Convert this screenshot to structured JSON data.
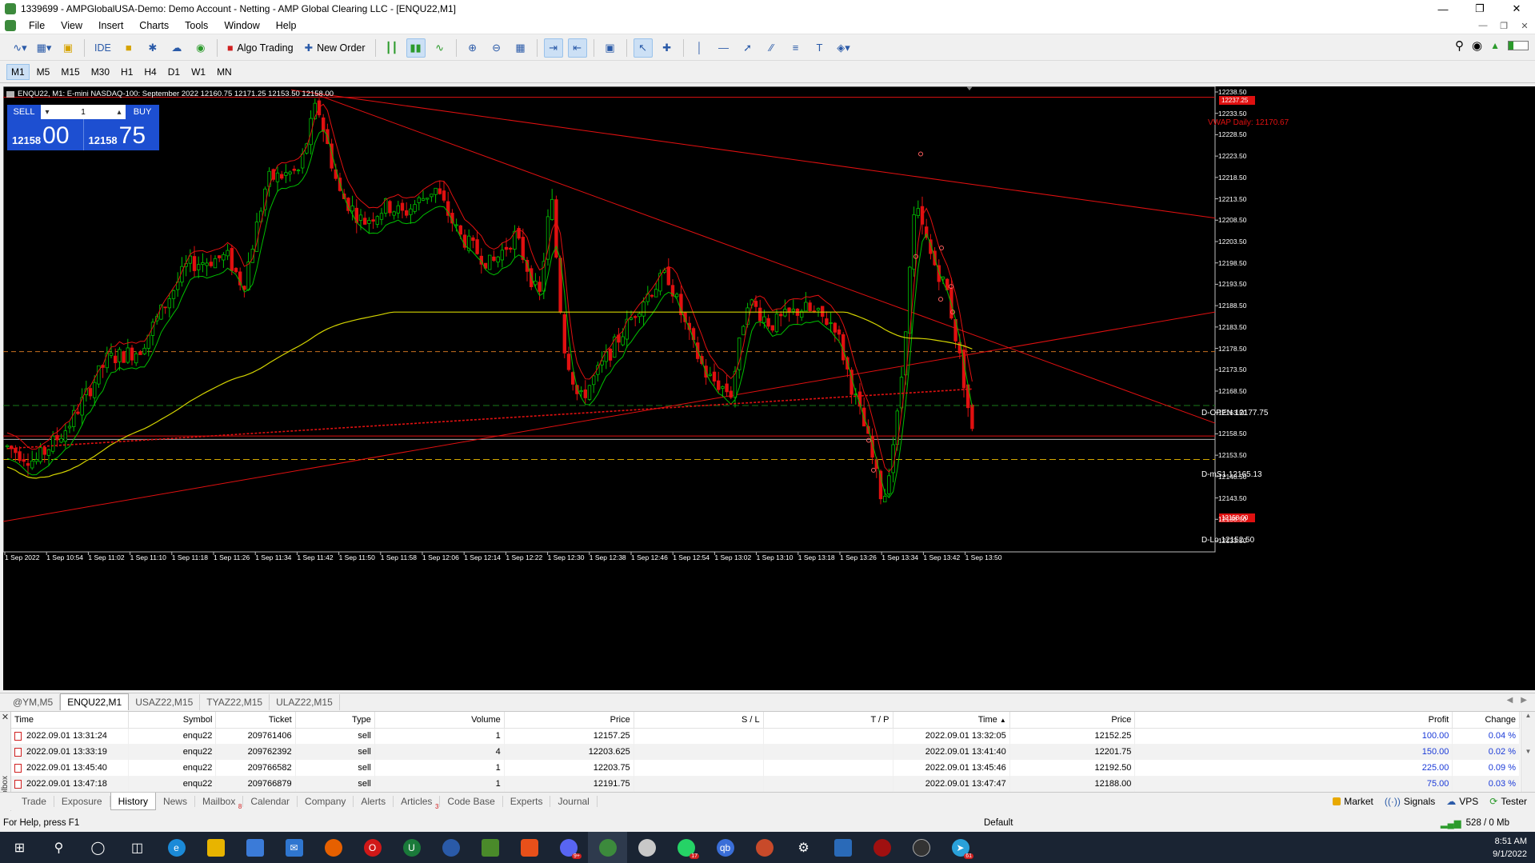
{
  "window": {
    "title": "1339699 - AMPGlobalUSA-Demo: Demo Account - Netting - AMP Global Clearing LLC - [ENQU22,M1]"
  },
  "menu": [
    "File",
    "View",
    "Insert",
    "Charts",
    "Tools",
    "Window",
    "Help"
  ],
  "toolbar": {
    "ide": "IDE",
    "algo_trading": "Algo Trading",
    "new_order": "New Order"
  },
  "timeframes": [
    "M1",
    "M5",
    "M15",
    "M30",
    "H1",
    "H4",
    "D1",
    "W1",
    "MN"
  ],
  "active_timeframe": "M1",
  "chart": {
    "header": "ENQU22, M1:  E-mini NASDAQ-100: September 2022   12160.75  12171.25  12153.50  12158.00",
    "trade_panel": {
      "sell": "SELL",
      "buy": "BUY",
      "qty": "1",
      "bid_small": "12158",
      "bid_big": "00",
      "ask_small": "12158",
      "ask_big": "75"
    },
    "vwap_label": "VWAP Daily: 12170.67",
    "levels": {
      "open": "D-OPEN 12177.75",
      "ms1": "D-mS1 12165.13",
      "lo": "D-Lo 12152.50"
    },
    "price_tag_top": "12237.25",
    "price_tag_current": "12158.00",
    "price_axis": [
      "12238.50",
      "12233.50",
      "12228.50",
      "12223.50",
      "12218.50",
      "12213.50",
      "12208.50",
      "12203.50",
      "12198.50",
      "12193.50",
      "12188.50",
      "12183.50",
      "12178.50",
      "12173.50",
      "12168.50",
      "12163.50",
      "12158.50",
      "12153.50",
      "12148.50",
      "12143.50",
      "12138.50",
      "12133.50"
    ],
    "time_axis": [
      "1 Sep 2022",
      "1 Sep 10:54",
      "1 Sep 11:02",
      "1 Sep 11:10",
      "1 Sep 11:18",
      "1 Sep 11:26",
      "1 Sep 11:34",
      "1 Sep 11:42",
      "1 Sep 11:50",
      "1 Sep 11:58",
      "1 Sep 12:06",
      "1 Sep 12:14",
      "1 Sep 12:22",
      "1 Sep 12:30",
      "1 Sep 12:38",
      "1 Sep 12:46",
      "1 Sep 12:54",
      "1 Sep 13:02",
      "1 Sep 13:10",
      "1 Sep 13:18",
      "1 Sep 13:26",
      "1 Sep 13:34",
      "1 Sep 13:42",
      "1 Sep 13:50"
    ],
    "colors": {
      "bull": "#00c000",
      "bear": "#e01010",
      "ma_fast_green": "#00c000",
      "ma_red": "#e01010",
      "ma_yellow": "#d4d400"
    }
  },
  "chart_tabs": [
    "@YM,M5",
    "ENQU22,M1",
    "USAZ22,M15",
    "TYAZ22,M15",
    "ULAZ22,M15"
  ],
  "active_chart_tab": "ENQU22,M1",
  "history": {
    "columns": [
      "Time",
      "Symbol",
      "Ticket",
      "Type",
      "Volume",
      "Price",
      "S / L",
      "T / P",
      "Time",
      "Price",
      "Profit",
      "Change"
    ],
    "rows": [
      [
        "2022.09.01 13:31:24",
        "enqu22",
        "209761406",
        "sell",
        "1",
        "12157.25",
        "",
        "",
        "2022.09.01 13:32:05",
        "12152.25",
        "100.00",
        "0.04 %"
      ],
      [
        "2022.09.01 13:33:19",
        "enqu22",
        "209762392",
        "sell",
        "4",
        "12203.625",
        "",
        "",
        "2022.09.01 13:41:40",
        "12201.75",
        "150.00",
        "0.02 %"
      ],
      [
        "2022.09.01 13:45:40",
        "enqu22",
        "209766582",
        "sell",
        "1",
        "12203.75",
        "",
        "",
        "2022.09.01 13:45:46",
        "12192.50",
        "225.00",
        "0.09 %"
      ],
      [
        "2022.09.01 13:47:18",
        "enqu22",
        "209766879",
        "sell",
        "1",
        "12191.75",
        "",
        "",
        "2022.09.01 13:47:47",
        "12188.00",
        "75.00",
        "0.03 %"
      ]
    ]
  },
  "toolbox_label": "Toolbox",
  "bottom_tabs": [
    {
      "label": "Trade",
      "badge": ""
    },
    {
      "label": "Exposure",
      "badge": ""
    },
    {
      "label": "History",
      "badge": ""
    },
    {
      "label": "News",
      "badge": ""
    },
    {
      "label": "Mailbox",
      "badge": "8"
    },
    {
      "label": "Calendar",
      "badge": ""
    },
    {
      "label": "Company",
      "badge": ""
    },
    {
      "label": "Alerts",
      "badge": ""
    },
    {
      "label": "Articles",
      "badge": "3"
    },
    {
      "label": "Code Base",
      "badge": ""
    },
    {
      "label": "Experts",
      "badge": ""
    },
    {
      "label": "Journal",
      "badge": ""
    }
  ],
  "active_bottom_tab": "History",
  "bottom_right": {
    "market": "Market",
    "signals": "Signals",
    "vps": "VPS",
    "tester": "Tester"
  },
  "status": {
    "help": "For Help, press F1",
    "profile": "Default",
    "traffic": "528 / 0 Mb"
  },
  "taskbar": {
    "time": "8:51 AM",
    "date": "9/1/2022",
    "badge_whatsapp": "17",
    "badge_telegram": "61",
    "badge_discord": "9+"
  }
}
